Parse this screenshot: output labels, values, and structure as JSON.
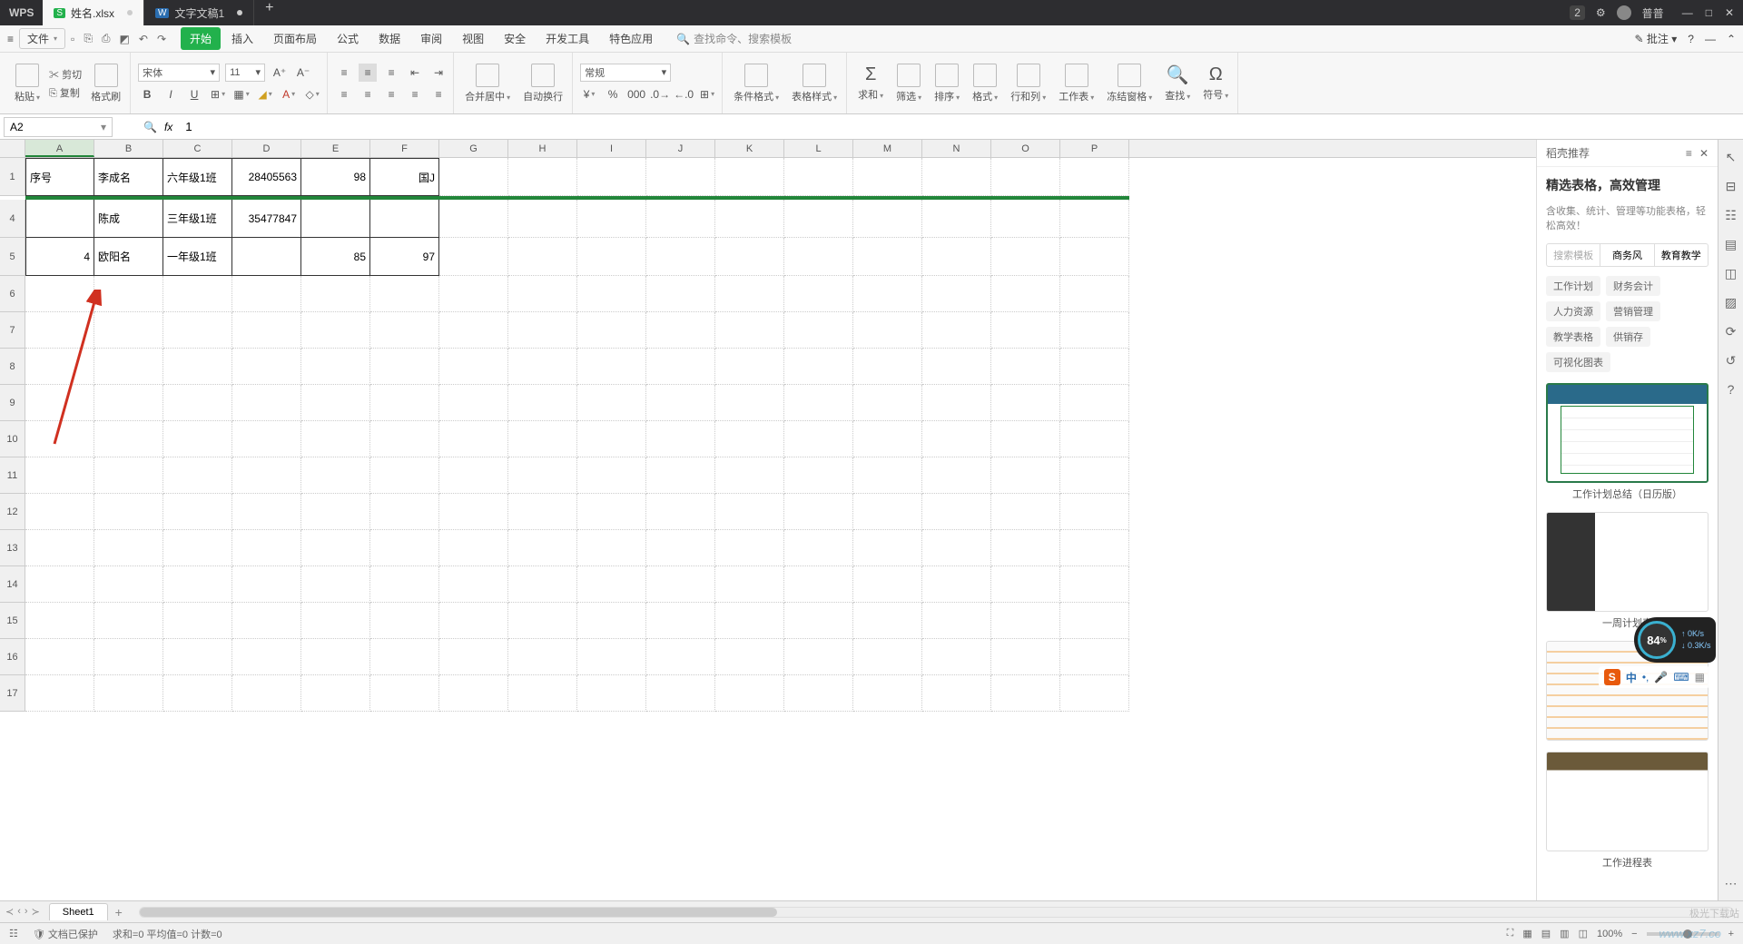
{
  "title_bar": {
    "app": "WPS",
    "tabs": [
      {
        "label": "姓名.xlsx",
        "icon": "S",
        "active": true
      },
      {
        "label": "文字文稿1",
        "icon": "W",
        "active": false
      }
    ],
    "badge": "2",
    "user": "普普"
  },
  "menu": {
    "file": "文件",
    "tabs": [
      "开始",
      "插入",
      "页面布局",
      "公式",
      "数据",
      "审阅",
      "视图",
      "安全",
      "开发工具",
      "特色应用"
    ],
    "active": "开始",
    "search_placeholder": "查找命令、搜索模板",
    "right_comment": "批注"
  },
  "ribbon": {
    "paste": "粘贴",
    "cut": "剪切",
    "copy": "复制",
    "format_painter": "格式刷",
    "font_name": "宋体",
    "font_size": "11",
    "merge_center": "合并居中",
    "auto_wrap": "自动换行",
    "number_format": "常规",
    "cond_format": "条件格式",
    "table_style": "表格样式",
    "sum": "求和",
    "filter": "筛选",
    "sort": "排序",
    "format": "格式",
    "row_col": "行和列",
    "worksheet": "工作表",
    "freeze": "冻结窗格",
    "find": "查找",
    "symbol": "符号"
  },
  "formula_bar": {
    "name_box": "A2",
    "formula": "1"
  },
  "columns": [
    "A",
    "B",
    "C",
    "D",
    "E",
    "F",
    "G",
    "H",
    "I",
    "J",
    "K",
    "L",
    "M",
    "N",
    "O",
    "P"
  ],
  "rows_visible": [
    "1",
    "4",
    "5",
    "6",
    "7",
    "8",
    "9",
    "10",
    "11",
    "12",
    "13",
    "14",
    "15",
    "16",
    "17"
  ],
  "sheet_data": {
    "r1": [
      "序号",
      "李成名",
      "六年级1班",
      "28405563",
      "98",
      "国J"
    ],
    "r4": [
      "",
      "陈成",
      "三年级1班",
      "35477847",
      "",
      ""
    ],
    "r5": [
      "4",
      "欧阳名",
      "一年级1班",
      "",
      "85",
      "97"
    ]
  },
  "template_panel": {
    "header": "稻壳推荐",
    "title": "精选表格，高效管理",
    "subtitle": "含收集、统计、管理等功能表格，轻松高效！",
    "filters": [
      "搜索模板",
      "商务风",
      "教育教学"
    ],
    "categories": [
      "工作计划",
      "财务会计",
      "人力资源",
      "营销管理",
      "教学表格",
      "供销存",
      "可视化图表"
    ],
    "items": [
      {
        "name": "工作计划总结（日历版）"
      },
      {
        "name": "一周计划表"
      },
      {
        "name": ""
      },
      {
        "name": "工作进程表"
      }
    ]
  },
  "sheet_tabs": {
    "active": "Sheet1"
  },
  "status_bar": {
    "protect": "文档已保护",
    "stats": "求和=0  平均值=0  计数=0",
    "zoom": "100%"
  },
  "overlay": {
    "pct": "84",
    "up": "0K/s",
    "down": "0.3K/s"
  },
  "ime": {
    "lang": "中"
  },
  "watermark": " www.xz7.co",
  "watermark2": "极光下载站"
}
